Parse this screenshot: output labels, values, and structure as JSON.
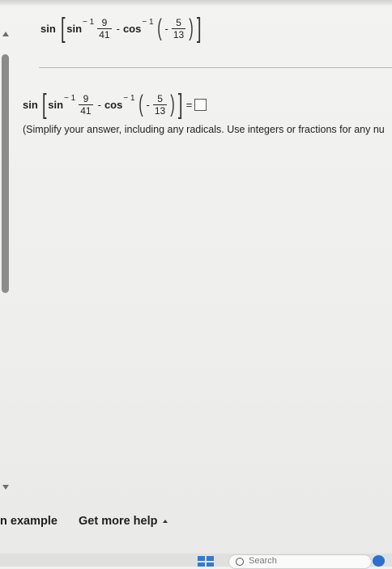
{
  "problem": {
    "header_expression": {
      "outer_fn": "sin",
      "inner_fn": "sin",
      "exp": "− 1",
      "frac1_num": "9",
      "frac1_den": "41",
      "minus": "-",
      "fn2": "cos",
      "exp2": "− 1",
      "neg": "-",
      "frac2_num": "5",
      "frac2_den": "13"
    },
    "answer_expression": {
      "outer_fn": "sin",
      "inner_fn": "sin",
      "exp": "− 1",
      "frac1_num": "9",
      "frac1_den": "41",
      "minus": "-",
      "fn2": "cos",
      "exp2": "− 1",
      "neg": "-",
      "frac2_num": "5",
      "frac2_den": "13",
      "equals": "="
    },
    "instruction": "(Simplify your answer, including any radicals. Use integers or fractions for any nu"
  },
  "footer": {
    "example_link": "n example",
    "help_link": "Get more help"
  },
  "taskbar": {
    "search_placeholder": "Search"
  }
}
